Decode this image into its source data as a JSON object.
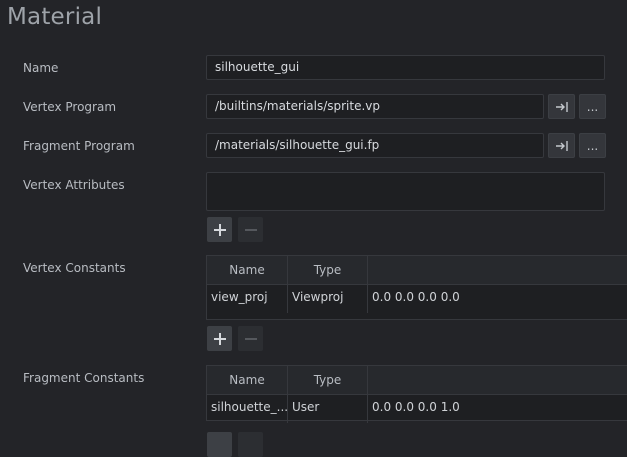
{
  "title": "Material",
  "name": {
    "label": "Name",
    "value": "silhouette_gui"
  },
  "vertex_program": {
    "label": "Vertex Program",
    "value": "/builtins/materials/sprite.vp",
    "browse_label": "..."
  },
  "fragment_program": {
    "label": "Fragment Program",
    "value": "/materials/silhouette_gui.fp",
    "browse_label": "..."
  },
  "vertex_attributes": {
    "label": "Vertex Attributes",
    "value": ""
  },
  "vertex_constants": {
    "label": "Vertex Constants",
    "columns": [
      "Name",
      "Type",
      ""
    ],
    "rows": [
      {
        "name": "view_proj",
        "type": "Viewproj",
        "value": "0.0  0.0  0.0  0.0"
      }
    ]
  },
  "fragment_constants": {
    "label": "Fragment Constants",
    "columns": [
      "Name",
      "Type",
      ""
    ],
    "rows": [
      {
        "name": "silhouette_...",
        "type": "User",
        "value": "0.0  0.0  0.0  1.0"
      }
    ]
  }
}
